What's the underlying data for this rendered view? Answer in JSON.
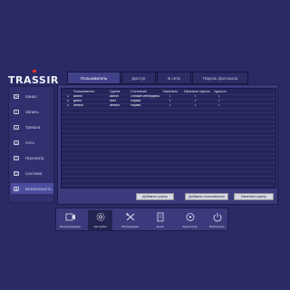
{
  "brand": "TRASSIR",
  "sidebar": {
    "items": [
      {
        "label": "Канал",
        "icon": "camera-icon",
        "active": false
      },
      {
        "label": "Запись",
        "icon": "record-icon",
        "active": false
      },
      {
        "label": "Тревога",
        "icon": "alarm-icon",
        "active": false
      },
      {
        "label": "Сеть",
        "icon": "network-icon",
        "active": false
      },
      {
        "label": "Просмотр",
        "icon": "view-icon",
        "active": false
      },
      {
        "label": "Система",
        "icon": "system-icon",
        "active": false
      },
      {
        "label": "Безопасность",
        "icon": "lock-icon",
        "active": true
      }
    ]
  },
  "tabs": [
    {
      "label": "Пользователь",
      "active": true
    },
    {
      "label": "Доступ",
      "active": false
    },
    {
      "label": "В сети",
      "active": false
    },
    {
      "label": "Пароль протокола",
      "active": false
    }
  ],
  "table": {
    "headers": [
      "Пользователь",
      "Группа",
      "Состояние",
      "Изменить",
      "Изменить пароль",
      "Удалить"
    ],
    "rows": [
      {
        "num": "1",
        "user": "admin",
        "group": "admin",
        "state": "Онлайн интерфейс",
        "edit": "•",
        "pwd": "•",
        "del": "•"
      },
      {
        "num": "2",
        "user": "guest",
        "group": "user",
        "state": "Норма",
        "edit": "•",
        "pwd": "•",
        "del": "•"
      },
      {
        "num": "3",
        "user": "default",
        "group": "default",
        "state": "Норма",
        "edit": "•",
        "pwd": "•",
        "del": "•"
      }
    ]
  },
  "buttons": {
    "add_group": "Добавить группу",
    "add_user": "Добавить пользователя",
    "change_group": "Изменить группу"
  },
  "dock": {
    "items": [
      {
        "label": "Воспроизведение",
        "icon": "playback-icon",
        "active": false
      },
      {
        "label": "Настройки",
        "icon": "settings-icon",
        "active": true
      },
      {
        "label": "Обслуживание",
        "icon": "tools-icon",
        "active": false
      },
      {
        "label": "Архив",
        "icon": "archive-icon",
        "active": false
      },
      {
        "label": "Аудиотестер",
        "icon": "audio-icon",
        "active": false
      },
      {
        "label": "Выключение",
        "icon": "power-icon",
        "active": false
      }
    ]
  },
  "colors": {
    "background": "#2a2a66",
    "panel": "#3a3a7c",
    "table": "#25255a",
    "accent_red": "#e83030"
  }
}
